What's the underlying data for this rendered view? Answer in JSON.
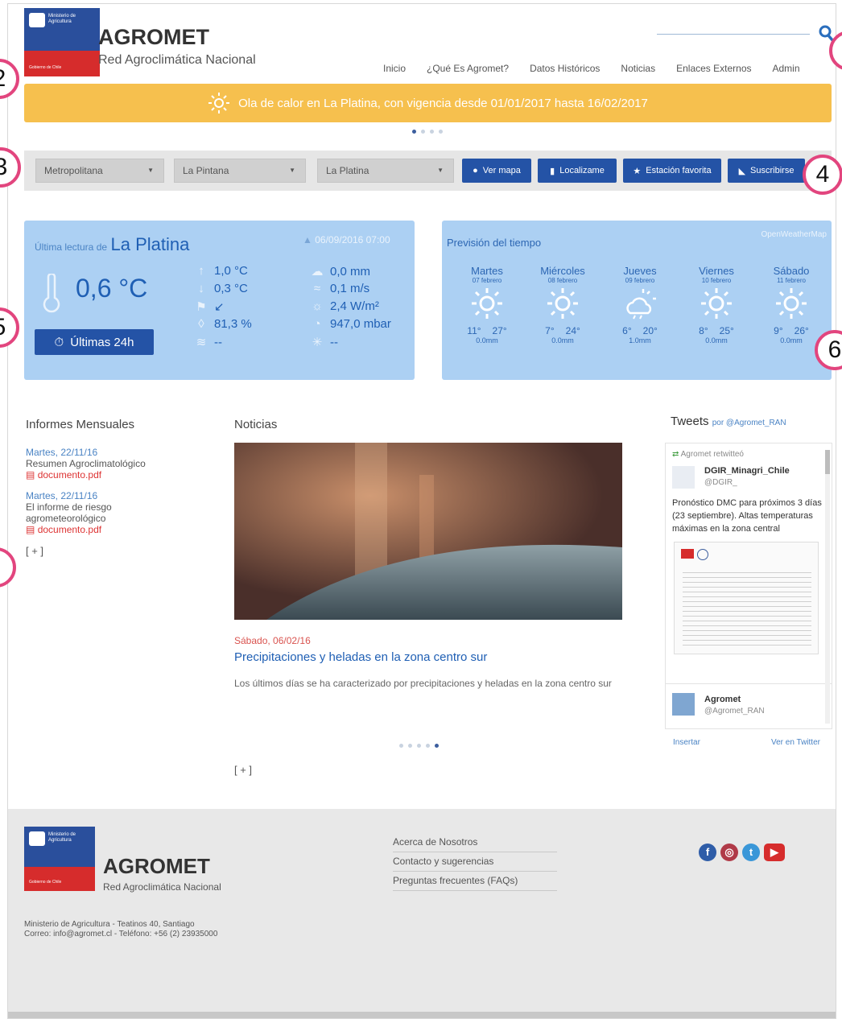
{
  "header": {
    "logo_ministry": "Ministerio de Agricultura",
    "logo_gov": "Gobierno de Chile",
    "brand": "AGROMET",
    "brand_sub": "Red Agroclimática Nacional",
    "nav": [
      "Inicio",
      "¿Qué Es Agromet?",
      "Datos Históricos",
      "Noticias",
      "Enlaces Externos",
      "Admin"
    ],
    "search_icon": "magnifier-icon"
  },
  "alert": {
    "text": "Ola de calor en La Platina, con vigencia desde 01/01/2017 hasta 16/02/2017",
    "color": "#f6c04e",
    "carousel_total": 4,
    "carousel_active": 1
  },
  "filters": {
    "region": "Metropolitana",
    "comuna": "La Pintana",
    "station": "La Platina",
    "buttons": [
      "Ver mapa",
      "Localizame",
      "Estación favorita",
      "Suscribirse"
    ]
  },
  "reading": {
    "prefix": "Última lectura de",
    "station": "La Platina",
    "timestamp": "06/09/2016 07:00",
    "temperature": "0,6 °C",
    "max_temp": "1,0 °C",
    "min_temp": "0,3 °C",
    "wind_dir": "↙",
    "humidity": "81,3 %",
    "unknown1": "--",
    "precipitation": "0,0 mm",
    "wind_speed": "0,1 m/s",
    "radiation": "2,4 W/m²",
    "pressure": "947,0 mbar",
    "unknown2": "--",
    "button_24h": "Últimas 24h"
  },
  "forecast": {
    "title": "Previsión del tiempo",
    "source": "OpenWeatherMap",
    "days": [
      {
        "name": "Martes",
        "date": "07 febrero",
        "min": "11°",
        "max": "27°",
        "rain": "0.0mm",
        "icon": "sun"
      },
      {
        "name": "Miércoles",
        "date": "08 febrero",
        "min": "7°",
        "max": "24°",
        "rain": "0.0mm",
        "icon": "sun"
      },
      {
        "name": "Jueves",
        "date": "09 febrero",
        "min": "6°",
        "max": "20°",
        "rain": "1.0mm",
        "icon": "cloud-sun"
      },
      {
        "name": "Viernes",
        "date": "10 febrero",
        "min": "8°",
        "max": "25°",
        "rain": "0.0mm",
        "icon": "sun"
      },
      {
        "name": "Sábado",
        "date": "11 febrero",
        "min": "9°",
        "max": "26°",
        "rain": "0.0mm",
        "icon": "sun"
      }
    ]
  },
  "informes": {
    "title": "Informes Mensuales",
    "items": [
      {
        "date": "Martes, 22/11/16",
        "text": "Resumen Agroclimatológico",
        "doc": "documento.pdf"
      },
      {
        "date": "Martes, 22/11/16",
        "text": "El informe de riesgo agrometeorológico",
        "doc": "documento.pdf"
      }
    ],
    "more": "[ + ]"
  },
  "noticias": {
    "title": "Noticias",
    "date": "Sábado, 06/02/16",
    "headline": "Precipitaciones y heladas en la zona centro sur",
    "summary": "Los últimos días se ha caracterizado por precipitaciones y heladas en la zona centro sur",
    "carousel_total": 5,
    "carousel_active": 5,
    "more": "[ + ]"
  },
  "tweets": {
    "title": "Tweets",
    "by": "por @Agromet_RAN",
    "retweet_label": "Agromet retwitteó",
    "author1": "DGIR_Minagri_Chile",
    "handle1": "@DGIR_",
    "text1": "Pronóstico DMC para próximos 3 días (23 septiembre). Altas temperaturas máximas en la zona central",
    "author2": "Agromet",
    "handle2": "@Agromet_RAN",
    "embed": "Insertar",
    "view": "Ver en Twitter"
  },
  "footer": {
    "brand": "AGROMET",
    "brand_sub": "Red Agroclimática Nacional",
    "address": "Ministerio de Agricultura - Teatinos 40, Santiago",
    "contact": "Correo: info@agromet.cl - Teléfono: +56 (2) 23935000",
    "links": [
      "Acerca de Nosotros",
      "Contacto y sugerencias",
      "Preguntas frecuentes (FAQs)"
    ],
    "social": [
      "facebook-icon",
      "instagram-icon",
      "twitter-icon",
      "youtube-icon"
    ]
  },
  "callouts": [
    "2",
    "3",
    "4",
    "5",
    "6"
  ]
}
